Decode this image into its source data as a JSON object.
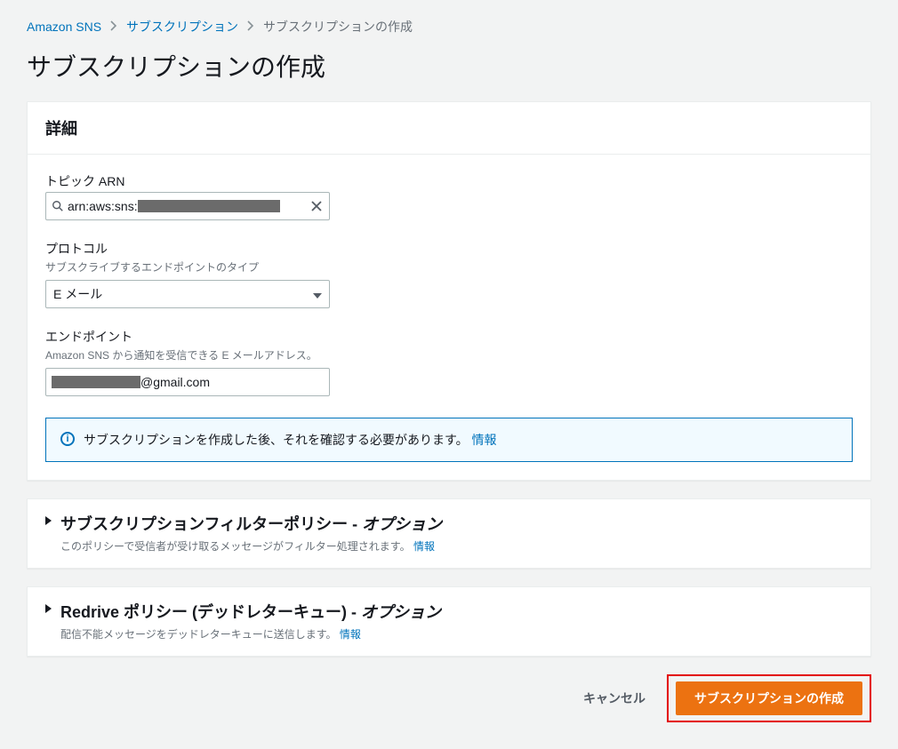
{
  "breadcrumb": {
    "service": "Amazon SNS",
    "section": "サブスクリプション",
    "current": "サブスクリプションの作成"
  },
  "page": {
    "title": "サブスクリプションの作成"
  },
  "details": {
    "header": "詳細",
    "topic_arn": {
      "label": "トピック ARN",
      "value_prefix": "arn:aws:sns:"
    },
    "protocol": {
      "label": "プロトコル",
      "desc": "サブスクライブするエンドポイントのタイプ",
      "value": "E メール"
    },
    "endpoint": {
      "label": "エンドポイント",
      "desc": "Amazon SNS から通知を受信できる E メールアドレス。",
      "value_suffix": "@gmail.com"
    },
    "notice": {
      "text": "サブスクリプションを作成した後、それを確認する必要があります。",
      "link": "情報"
    }
  },
  "filter_policy": {
    "title": "サブスクリプションフィルターポリシー - ",
    "title_suffix": "オプション",
    "desc": "このポリシーで受信者が受け取るメッセージがフィルター処理されます。",
    "link": "情報"
  },
  "redrive_policy": {
    "title": "Redrive ポリシー (デッドレターキュー) - ",
    "title_suffix": "オプション",
    "desc": "配信不能メッセージをデッドレターキューに送信します。",
    "link": "情報"
  },
  "actions": {
    "cancel": "キャンセル",
    "submit": "サブスクリプションの作成"
  }
}
